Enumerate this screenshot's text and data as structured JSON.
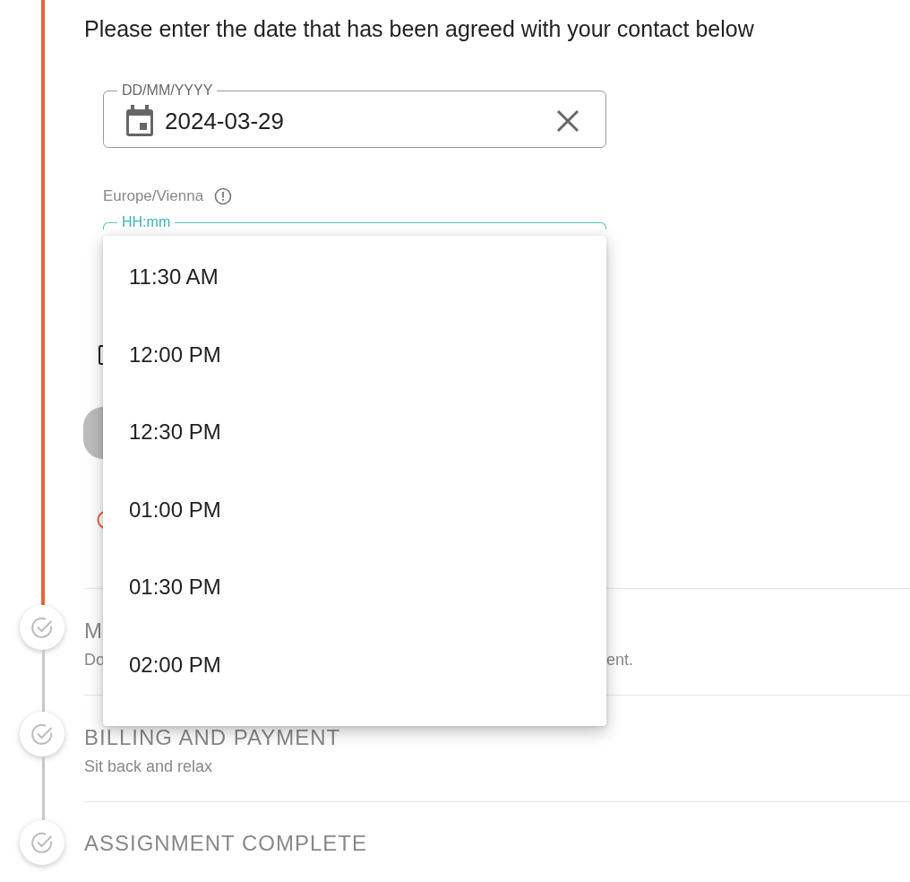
{
  "active_step": {
    "instruction": "Please enter the date that has been agreed with your contact below",
    "date_field": {
      "label": "DD/MM/YYYY",
      "value": "2024-03-29"
    },
    "timezone": "Europe/Vienna",
    "time_field": {
      "label": "HH:mm",
      "focused": true
    },
    "checkbox": {
      "checked": false
    }
  },
  "time_menu": {
    "options": [
      {
        "label": "11:30 AM",
        "selected": false
      },
      {
        "label": "12:00 PM",
        "selected": false
      },
      {
        "label": "12:30 PM",
        "selected": false
      },
      {
        "label": "01:00 PM",
        "selected": false
      },
      {
        "label": "01:30 PM",
        "selected": false
      },
      {
        "label": "02:00 PM",
        "selected": false
      }
    ]
  },
  "steps": [
    {
      "title": "M",
      "subtitle_start": "Do",
      "subtitle_end": "ent."
    },
    {
      "title": "BILLING AND PAYMENT",
      "subtitle_start": "Sit back and relax"
    },
    {
      "title": "ASSIGNMENT COMPLETE"
    }
  ]
}
